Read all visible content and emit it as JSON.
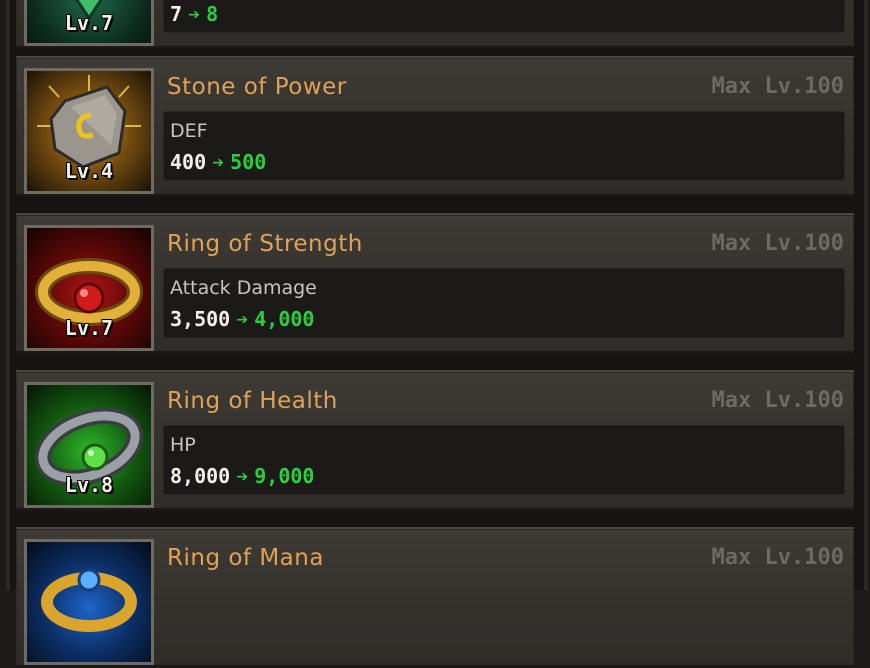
{
  "items": [
    {
      "name": "",
      "max": "",
      "level": "Lv.7",
      "stat_label": "",
      "from": "7",
      "to": "8",
      "icon": "green-gem-icon",
      "accent": "#1f6b4a"
    },
    {
      "name": "Stone of Power",
      "max": "Max Lv.100",
      "level": "Lv.4",
      "stat_label": "DEF",
      "from": "400",
      "to": "500",
      "icon": "rune-stone-icon",
      "accent": "#d9a02a"
    },
    {
      "name": "Ring of Strength",
      "max": "Max Lv.100",
      "level": "Lv.7",
      "stat_label": "Attack Damage",
      "from": "3,500",
      "to": "4,000",
      "icon": "ruby-ring-icon",
      "accent": "#b01515"
    },
    {
      "name": "Ring of Health",
      "max": "Max Lv.100",
      "level": "Lv.8",
      "stat_label": "HP",
      "from": "8,000",
      "to": "9,000",
      "icon": "emerald-ring-icon",
      "accent": "#2fb52a"
    },
    {
      "name": "Ring of Mana",
      "max": "Max Lv.100",
      "level": "",
      "stat_label": "",
      "from": "",
      "to": "",
      "icon": "sapphire-ring-icon",
      "accent": "#1e64c8"
    }
  ],
  "arrow_glyph": "➔"
}
